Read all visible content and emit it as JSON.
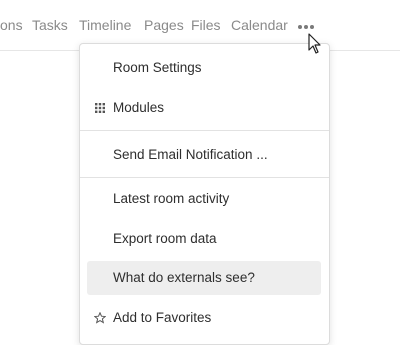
{
  "nav": {
    "items": [
      "ons",
      "Tasks",
      "Timeline",
      "Pages",
      "Files",
      "Calendar"
    ],
    "more_icon": "more-horizontal-icon"
  },
  "menu": {
    "items": [
      {
        "label": "Room Settings",
        "icon": ""
      },
      {
        "label": "Modules",
        "icon": "grid-icon"
      },
      {
        "label": "Send Email Notification ...",
        "icon": ""
      },
      {
        "label": "Latest room activity",
        "icon": ""
      },
      {
        "label": "Export room data",
        "icon": ""
      },
      {
        "label": "What do externals see?",
        "icon": "",
        "highlighted": true
      },
      {
        "label": "Add to Favorites",
        "icon": "star-outline-icon"
      }
    ]
  },
  "colors": {
    "nav_text": "#8a8a8a",
    "menu_text": "#2e2e2e",
    "highlight_bg": "#eeeeee"
  }
}
